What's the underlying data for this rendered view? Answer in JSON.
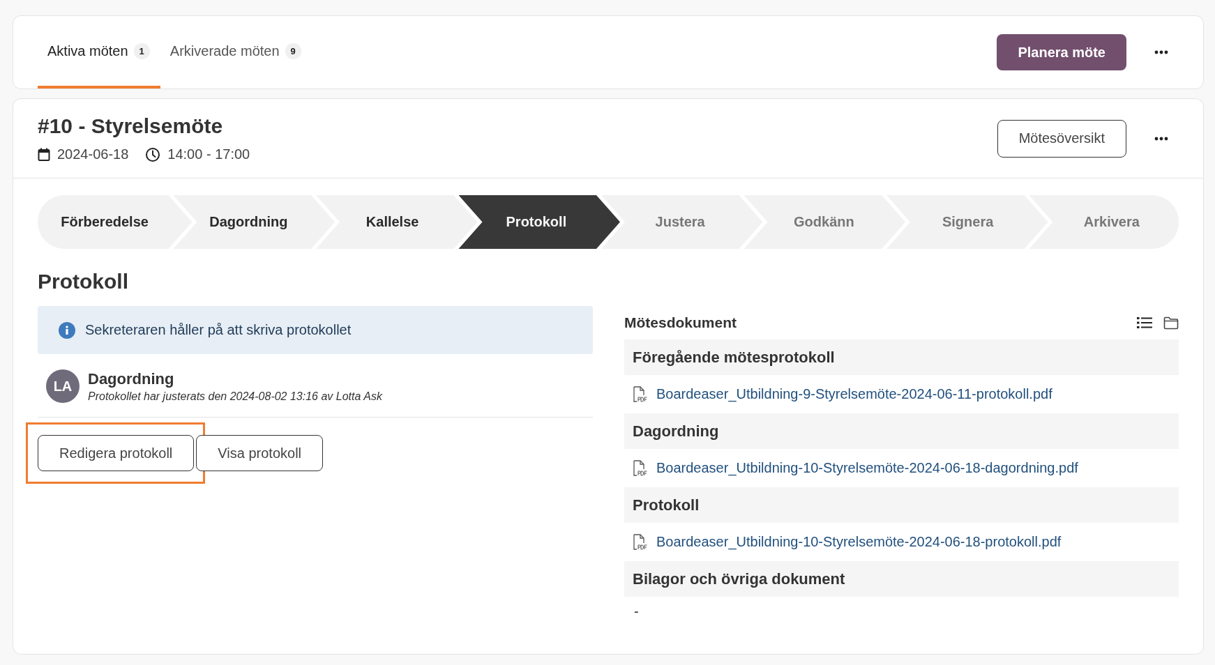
{
  "tabs": [
    {
      "label": "Aktiva möten",
      "count": "1",
      "selected": true
    },
    {
      "label": "Arkiverade möten",
      "count": "9",
      "selected": false
    }
  ],
  "plan_button": "Planera möte",
  "meeting": {
    "title": "#10 - Styrelsemöte",
    "date": "2024-06-18",
    "time": "14:00 - 17:00",
    "overview_button": "Mötesöversikt"
  },
  "steps": [
    {
      "label": "Förberedelse",
      "completed": true,
      "selected": false
    },
    {
      "label": "Dagordning",
      "completed": true,
      "selected": false
    },
    {
      "label": "Kallelse",
      "completed": true,
      "selected": false
    },
    {
      "label": "Protokoll",
      "completed": false,
      "selected": true
    },
    {
      "label": "Justera",
      "completed": false,
      "selected": false
    },
    {
      "label": "Godkänn",
      "completed": false,
      "selected": false
    },
    {
      "label": "Signera",
      "completed": false,
      "selected": false
    },
    {
      "label": "Arkivera",
      "completed": false,
      "selected": false
    }
  ],
  "section_title": "Protokoll",
  "info": "Sekreteraren håller på att skriva protokollet",
  "activity": {
    "initials": "LA",
    "title": "Dagordning",
    "note": "Protokollet har justerats den 2024-08-02 13:16 av Lotta Ask"
  },
  "buttons": [
    {
      "label": "Redigera protokoll",
      "highlighted": true
    },
    {
      "label": "Visa protokoll",
      "highlighted": false
    }
  ],
  "documents": {
    "title": "Mötesdokument",
    "groups": [
      {
        "heading": "Föregående mötesprotokoll",
        "files": [
          "Boardeaser_Utbildning-9-Styrelsemöte-2024-06-11-protokoll.pdf"
        ]
      },
      {
        "heading": "Dagordning",
        "files": [
          "Boardeaser_Utbildning-10-Styrelsemöte-2024-06-18-dagordning.pdf"
        ]
      },
      {
        "heading": "Protokoll",
        "files": [
          "Boardeaser_Utbildning-10-Styrelsemöte-2024-06-18-protokoll.pdf"
        ]
      },
      {
        "heading": "Bilagor och övriga dokument",
        "empty_text": "-"
      }
    ]
  }
}
